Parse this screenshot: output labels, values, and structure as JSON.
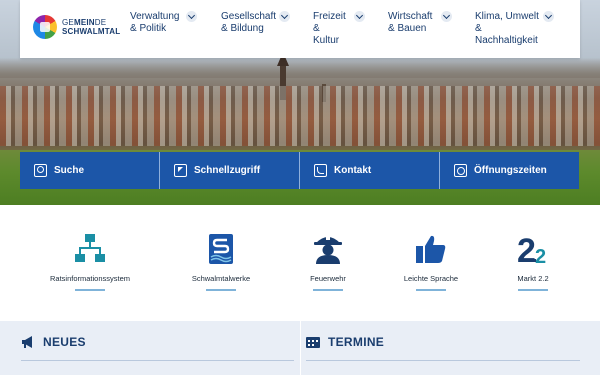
{
  "logo": {
    "line1_pre": "GE",
    "line1_bold": "MEIN",
    "line1_post": "DE",
    "line2": "SCHWALMTAL"
  },
  "nav": [
    {
      "lines": [
        "Verwaltung",
        "& Politik"
      ]
    },
    {
      "lines": [
        "Gesellschaft",
        "& Bildung"
      ]
    },
    {
      "lines": [
        "Freizeit",
        "&",
        "Kultur"
      ]
    },
    {
      "lines": [
        "Wirtschaft",
        "& Bauen"
      ]
    },
    {
      "lines": [
        "Klima, Umwelt",
        "&",
        "Nachhaltigkeit"
      ]
    }
  ],
  "quick_links": [
    {
      "label": "Suche",
      "icon": "search-icon"
    },
    {
      "label": "Schnellzugriff",
      "icon": "cursor-icon"
    },
    {
      "label": "Kontakt",
      "icon": "phone-icon"
    },
    {
      "label": "Öffnungszeiten",
      "icon": "clock-icon"
    }
  ],
  "services": [
    {
      "label": "Ratsinformationssystem",
      "icon": "org-chart-icon"
    },
    {
      "label": "Schwalmtalwerke",
      "icon": "water-s-icon"
    },
    {
      "label": "Feuerwehr",
      "icon": "firefighter-icon"
    },
    {
      "label": "Leichte Sprache",
      "icon": "thumbs-up-icon"
    },
    {
      "label": "Markt 2.2",
      "icon": "markt-logo-icon",
      "logo_text": "2.2"
    }
  ],
  "sections": {
    "news": {
      "title": "NEUES",
      "icon": "megaphone-icon"
    },
    "events": {
      "title": "TERMINE",
      "icon": "calendar-icon"
    }
  },
  "colors": {
    "primary_blue": "#1c56a8",
    "navy": "#1a3d6e",
    "teal": "#1a8fa5",
    "light_bg": "#e9eef6"
  }
}
